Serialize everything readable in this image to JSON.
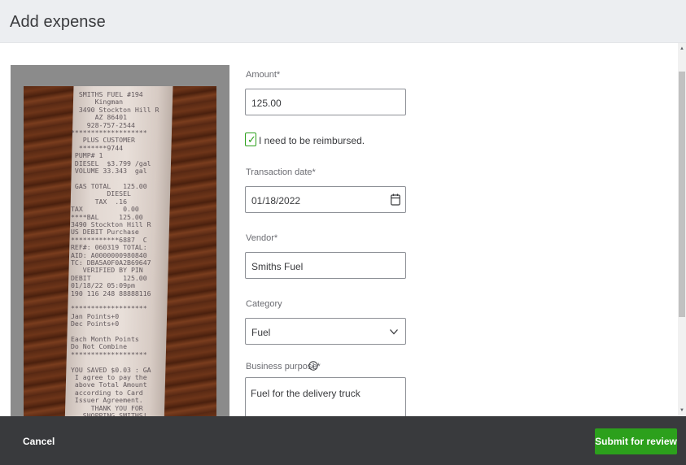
{
  "header": {
    "title": "Add expense"
  },
  "receipt": {
    "text_lines": [
      "  SMITHS FUEL #194",
      "      Kingman",
      "  3490 Stockton Hill R",
      "      AZ 86401",
      "    928-757-2544",
      "*******************",
      "   PLUS CUSTOMER",
      "  *******9744",
      " PUMP# 1",
      " DIESEL  $3.799 /gal",
      " VOLUME 33.343  gal",
      "",
      " GAS TOTAL   125.00",
      "         DIESEL",
      "      TAX  .16",
      "TAX          0.00",
      "****BAL     125.00",
      "3490 Stockton Hill R",
      "US DEBIT Purchase",
      "************6887  C",
      "REF#: 060319 TOTAL:",
      "AID: A0000000980840",
      "TC: DBA5A0F0A2B69647",
      "   VERIFIED BY PIN",
      "DEBIT        125.00",
      "01/18/22 05:09pm",
      "190 116 248 88888116",
      "",
      "*******************",
      "Jan Points+0",
      "Dec Points+0",
      "",
      "Each Month Points",
      "Do Not Combine",
      "*******************",
      "",
      "YOU SAVED $0.03 : GA",
      " I agree to pay the",
      " above Total Amount",
      " according to Card",
      " Issuer Agreement.",
      "     THANK YOU FOR",
      "   SHOPPING SMITHS!"
    ]
  },
  "form": {
    "amount": {
      "label": "Amount*",
      "value": "125.00"
    },
    "reimburse": {
      "label": "I need to be reimbursed.",
      "checked": true
    },
    "transaction_date": {
      "label": "Transaction date*",
      "value": "01/18/2022"
    },
    "vendor": {
      "label": "Vendor*",
      "value": "Smiths Fuel"
    },
    "category": {
      "label": "Category",
      "value": "Fuel"
    },
    "business_purpose": {
      "label": "Business purpose*",
      "value": "Fuel for the delivery truck"
    }
  },
  "footer": {
    "cancel_label": "Cancel",
    "submit_label": "Submit for review"
  },
  "colors": {
    "accent": "#2ca01c",
    "footer_bg": "#393a3d",
    "header_bg": "#eceef1"
  },
  "icons": {
    "calendar": "calendar-icon",
    "chevron": "chevron-down-icon",
    "info": "info-icon",
    "check": "checkmark-icon"
  }
}
